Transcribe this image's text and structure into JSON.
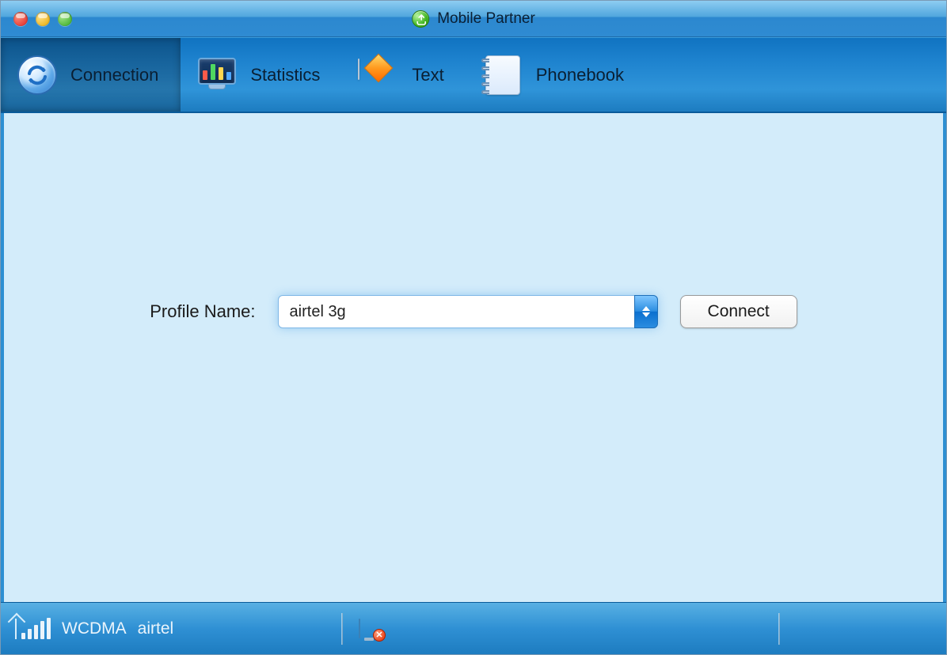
{
  "window": {
    "title": "Mobile Partner"
  },
  "tabs": {
    "connection": "Connection",
    "statistics": "Statistics",
    "text": "Text",
    "phonebook": "Phonebook",
    "active": "connection"
  },
  "form": {
    "profile_label": "Profile Name:",
    "profile_value": "airtel 3g",
    "connect_label": "Connect"
  },
  "status": {
    "network_mode": "WCDMA",
    "carrier": "airtel"
  }
}
